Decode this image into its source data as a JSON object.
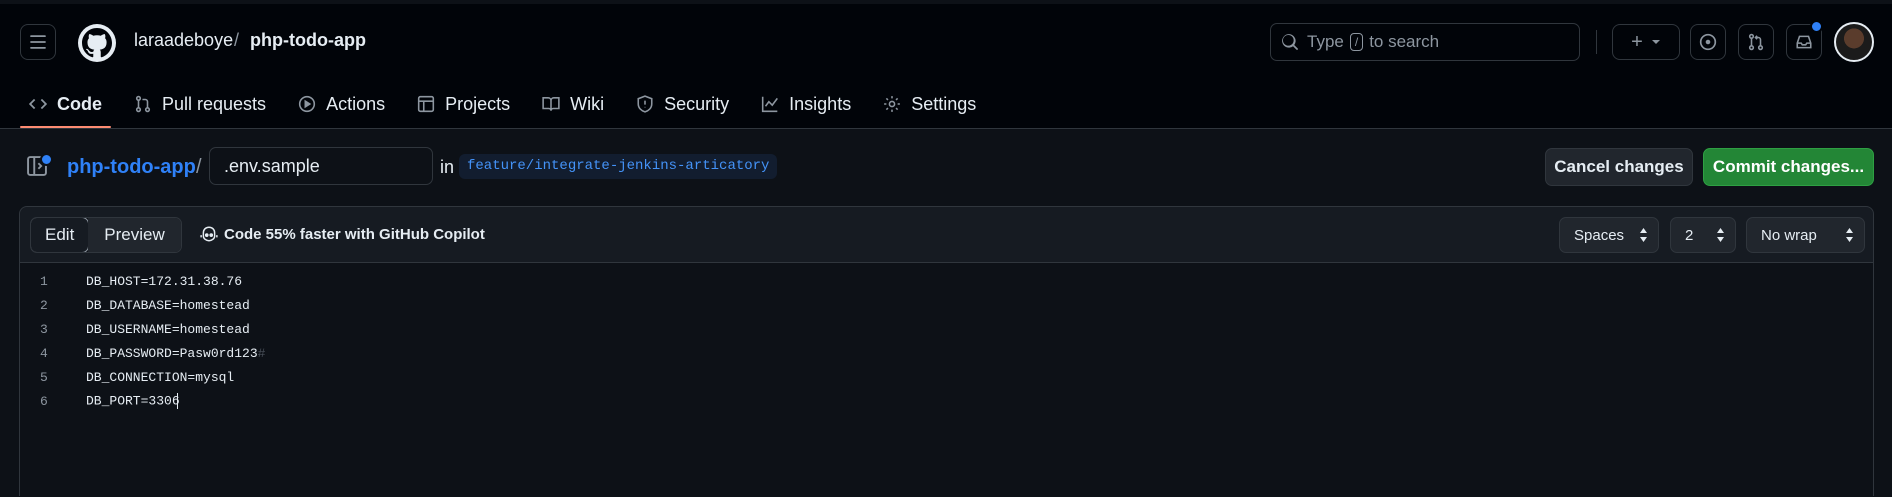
{
  "header": {
    "owner": "laraadeboye",
    "separator": "/",
    "repo": "php-todo-app",
    "search": {
      "prefix": "Type",
      "shortcut": "/",
      "suffix": "to search"
    },
    "plus_label": "+"
  },
  "tabs": [
    {
      "label": "Code",
      "icon": "code-icon",
      "active": true
    },
    {
      "label": "Pull requests",
      "icon": "pull-request-icon"
    },
    {
      "label": "Actions",
      "icon": "play-icon"
    },
    {
      "label": "Projects",
      "icon": "table-icon"
    },
    {
      "label": "Wiki",
      "icon": "book-icon"
    },
    {
      "label": "Security",
      "icon": "shield-icon"
    },
    {
      "label": "Insights",
      "icon": "graph-icon"
    },
    {
      "label": "Settings",
      "icon": "gear-icon"
    }
  ],
  "editor": {
    "repo_link": "php-todo-app",
    "slash": "/",
    "filename": ".env.sample",
    "in_label": "in",
    "branch": "feature/integrate-jenkins-articatory",
    "cancel_label": "Cancel changes",
    "commit_label": "Commit changes..."
  },
  "toolbar": {
    "edit_label": "Edit",
    "preview_label": "Preview",
    "copilot_label": "Code 55% faster with GitHub Copilot",
    "indent_mode": "Spaces",
    "indent_size": "2",
    "wrap_mode": "No wrap"
  },
  "code_lines": [
    {
      "num": "1",
      "text": "DB_HOST=172.31.38.76"
    },
    {
      "num": "2",
      "text": "DB_DATABASE=homestead"
    },
    {
      "num": "3",
      "text": "DB_USERNAME=homestead"
    },
    {
      "num": "4",
      "text": "DB_PASSWORD=Pasw0rd123",
      "trailing": "#"
    },
    {
      "num": "5",
      "text": "DB_CONNECTION=mysql"
    },
    {
      "num": "6",
      "text": "DB_PORT=3306"
    }
  ],
  "colors": {
    "accent_blue": "#2f81f7",
    "commit_green": "#238636",
    "active_tab_underline": "#fd8c73",
    "background": "#0d1117"
  }
}
